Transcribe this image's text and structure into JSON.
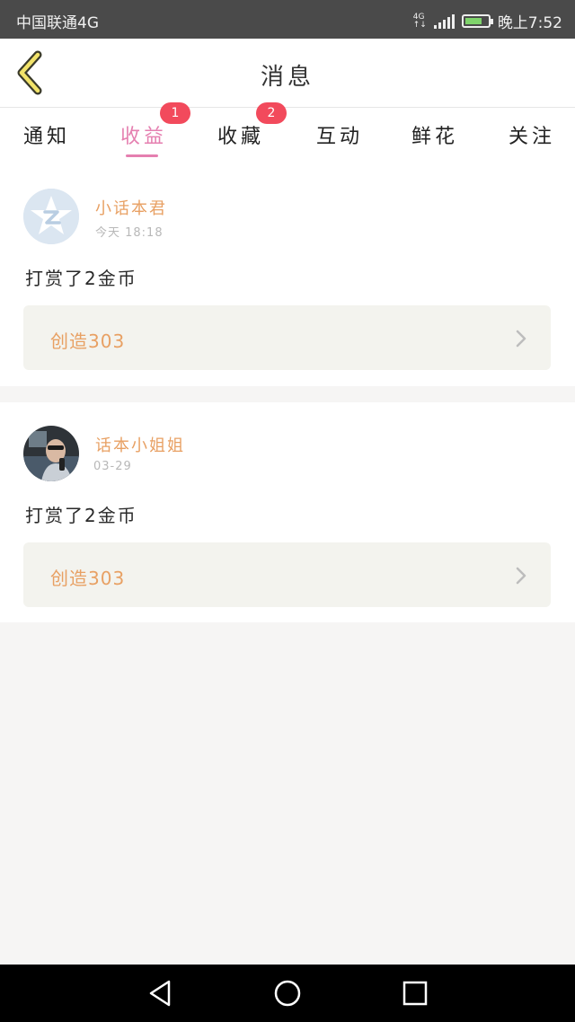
{
  "status_bar": {
    "carrier": "中国联通4G",
    "network_tag_top": "4G",
    "network_tag_bottom": "↑↓",
    "time": "晚上7:52"
  },
  "header": {
    "title": "消息",
    "back_icon": "chevron-left-icon"
  },
  "tabs": [
    {
      "label": "通知",
      "active": false
    },
    {
      "label": "收益",
      "active": true,
      "badge": "1"
    },
    {
      "label": "收藏",
      "active": false,
      "badge": "2"
    },
    {
      "label": "互动",
      "active": false
    },
    {
      "label": "鲜花",
      "active": false
    },
    {
      "label": "关注",
      "active": false
    }
  ],
  "messages": [
    {
      "user": "小话本君",
      "time": "今天 18:18",
      "text": "打赏了2金币",
      "link": "创造303",
      "avatar": "qzone-logo"
    },
    {
      "user": "话本小姐姐",
      "time": "03-29",
      "text": "打赏了2金币",
      "link": "创造303",
      "avatar": "user-photo"
    }
  ],
  "colors": {
    "accent_pink": "#e57fb0",
    "username_orange": "#e8a063",
    "badge_red": "#f24a5c",
    "back_arrow_yellow": "#f2e36a"
  },
  "nav_bar": {
    "icons": [
      "back-triangle-icon",
      "home-circle-icon",
      "recents-square-icon"
    ]
  }
}
